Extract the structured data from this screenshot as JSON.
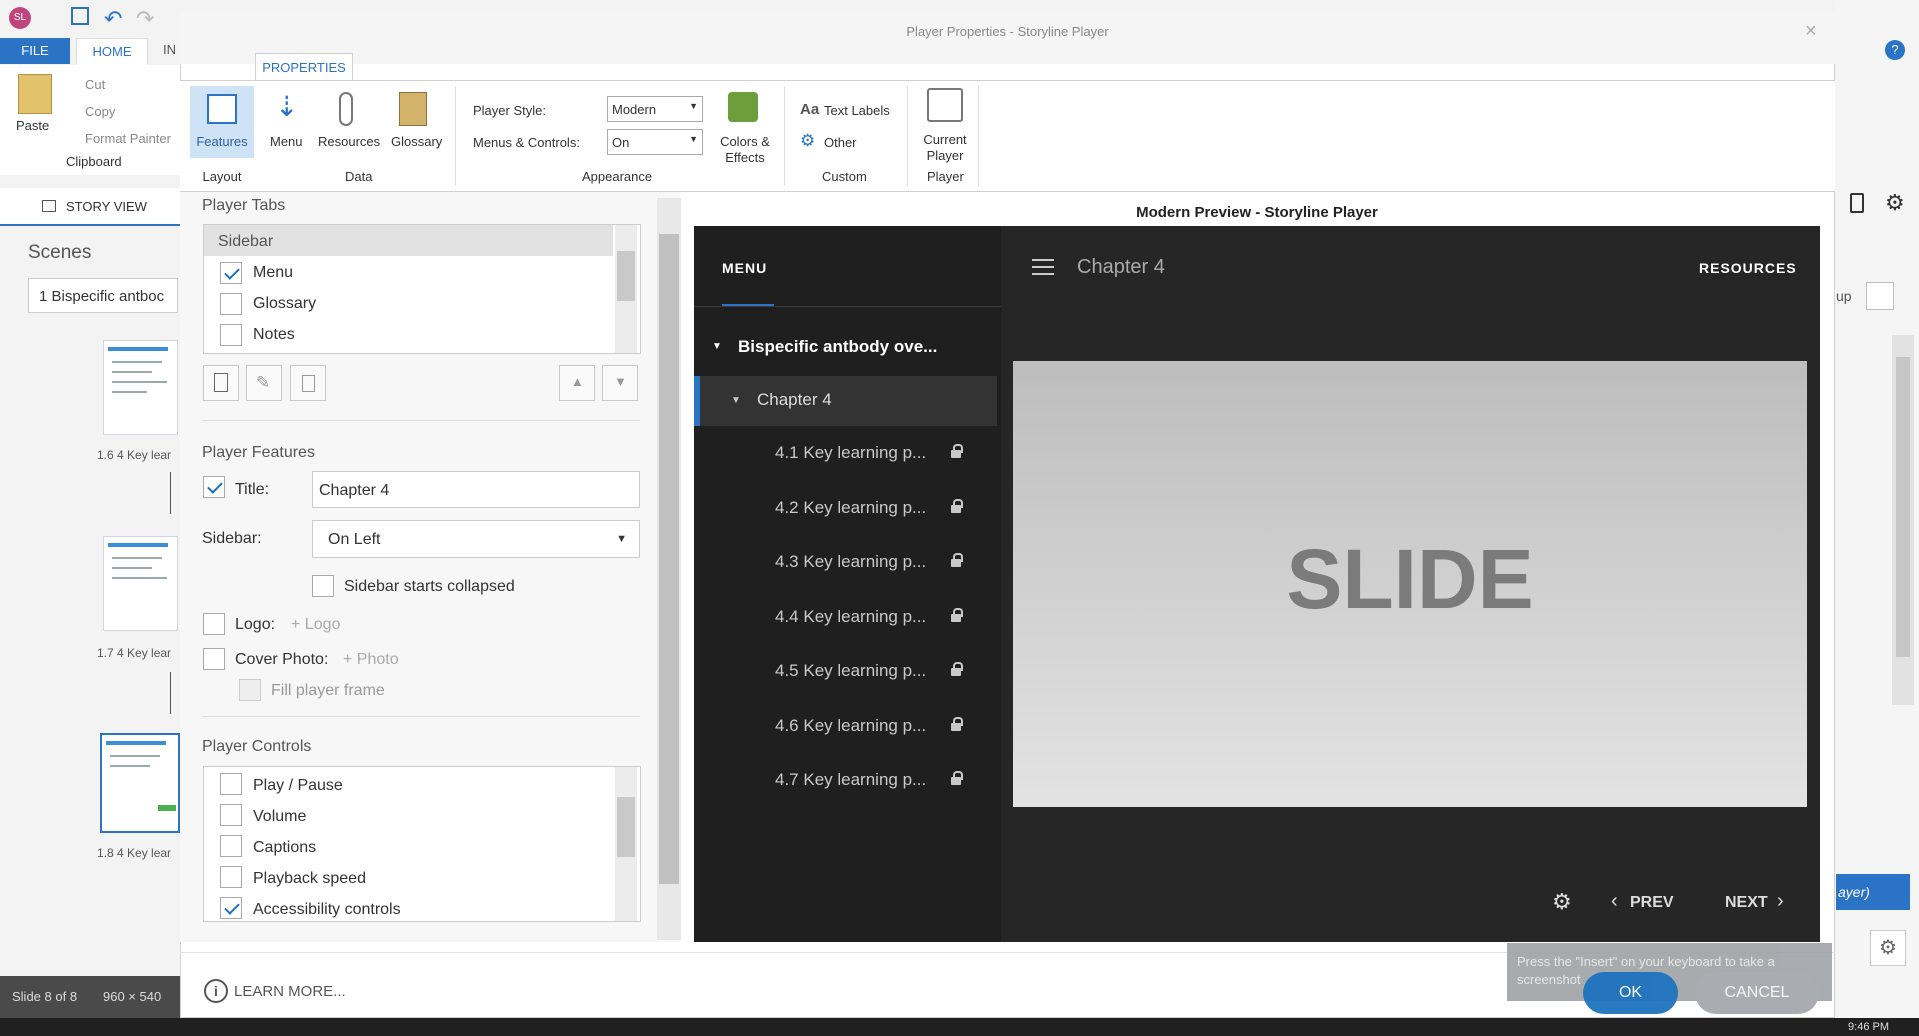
{
  "app": {
    "avatar": "SL",
    "tabs": [
      "FILE",
      "HOME",
      "IN"
    ],
    "clipboard": {
      "paste": "Paste",
      "cut": "Cut",
      "copy": "Copy",
      "format_painter": "Format Painter",
      "group": "Clipboard"
    },
    "story_view": "STORY VIEW",
    "scenes_label": "Scenes",
    "scene_select": "1 Bispecific antboc",
    "slides": [
      {
        "label": "1.6 4 Key lear"
      },
      {
        "label": "1.7 4 Key lear"
      },
      {
        "label": "1.8 4 Key lear"
      }
    ],
    "status": {
      "slide": "Slide 8 of 8",
      "size": "960 × 540"
    },
    "right_partial": {
      "up": "up",
      "player_btn": "ayer)"
    },
    "help": "?"
  },
  "dialog": {
    "title": "Player Properties - Storyline Player",
    "ribbon_tab": "PROPERTIES",
    "ribbon": {
      "features": "Features",
      "layout_group": "Layout",
      "menu": "Menu",
      "resources": "Resources",
      "glossary": "Glossary",
      "data_group": "Data",
      "player_style_label": "Player Style:",
      "player_style_value": "Modern",
      "menus_controls_label": "Menus & Controls:",
      "menus_controls_value": "On",
      "colors_effects": "Colors & Effects",
      "appearance_group": "Appearance",
      "text_labels": "Text Labels",
      "other": "Other",
      "custom_group": "Custom",
      "current_player": "Current Player",
      "player_group": "Player"
    },
    "player_tabs": {
      "heading": "Player Tabs",
      "header_row": "Sidebar",
      "items": [
        {
          "label": "Menu",
          "checked": true
        },
        {
          "label": "Glossary",
          "checked": false
        },
        {
          "label": "Notes",
          "checked": false
        }
      ]
    },
    "player_features": {
      "heading": "Player Features",
      "title_label": "Title:",
      "title_value": "Chapter 4",
      "title_checked": true,
      "sidebar_label": "Sidebar:",
      "sidebar_value": "On Left",
      "sidebar_collapsed": "Sidebar starts collapsed",
      "logo_label": "Logo:",
      "logo_add": "+ Logo",
      "cover_label": "Cover Photo:",
      "cover_add": "+ Photo",
      "fill_frame": "Fill player frame"
    },
    "player_controls": {
      "heading": "Player Controls",
      "items": [
        {
          "label": "Play / Pause",
          "checked": false
        },
        {
          "label": "Volume",
          "checked": false
        },
        {
          "label": "Captions",
          "checked": false
        },
        {
          "label": "Playback speed",
          "checked": false
        },
        {
          "label": "Accessibility controls",
          "checked": true
        }
      ]
    },
    "learn_more": "LEARN MORE...",
    "ok": "OK",
    "cancel": "CANCEL",
    "tooltip": "Press the \"Insert\" on your keyboard to take a screenshot"
  },
  "preview": {
    "heading": "Modern Preview - Storyline Player",
    "menu_tab": "MENU",
    "title": "Chapter 4",
    "resources": "RESOURCES",
    "course": "Bispecific antbody ove...",
    "chapter": "Chapter 4",
    "items": [
      "4.1 Key learning p...",
      "4.2 Key learning p...",
      "4.3 Key learning p...",
      "4.4 Key learning p...",
      "4.5 Key learning p...",
      "4.6 Key learning p...",
      "4.7 Key learning p..."
    ],
    "slide_text": "SLIDE",
    "prev": "PREV",
    "next": "NEXT"
  },
  "taskbar": {
    "time": "9:46 PM"
  },
  "colors": {
    "accent": "#2b73c5",
    "player_bg": "#262626",
    "player_sidebar": "#1f1f1f",
    "ok_button": "#1e73be"
  }
}
